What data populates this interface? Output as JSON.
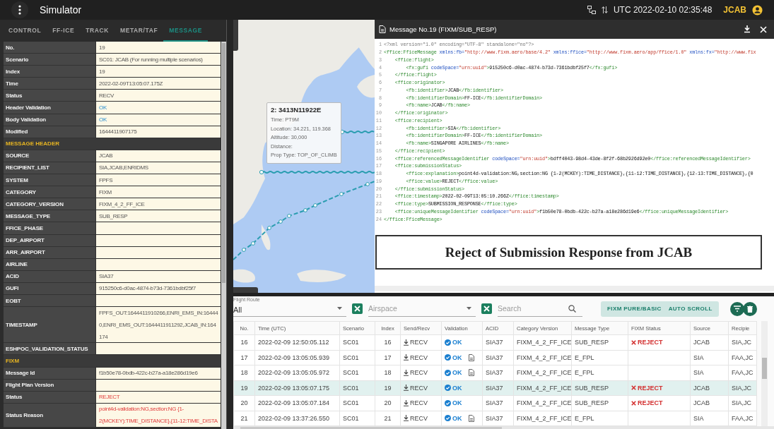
{
  "app_bar": {
    "title": "Simulator",
    "clock": "UTC 2022-02-10 02:35:48",
    "user": "JCAB"
  },
  "tabs": [
    {
      "label": "CONTROL",
      "selected": false
    },
    {
      "label": "FF-ICE",
      "selected": false
    },
    {
      "label": "TRACK",
      "selected": false
    },
    {
      "label": "METAR/TAF",
      "selected": false
    },
    {
      "label": "MESSAGE",
      "selected": true
    }
  ],
  "details": [
    {
      "kind": "field",
      "label": "No.",
      "value": "19"
    },
    {
      "kind": "field",
      "label": "Scenario",
      "value": "SC01: JCAB (For running multiple scenarios)"
    },
    {
      "kind": "field",
      "label": "Index",
      "value": "19"
    },
    {
      "kind": "field",
      "label": "Time",
      "value": "2022-02-09T13:05:07.175Z"
    },
    {
      "kind": "field",
      "label": "Status",
      "value": "RECV"
    },
    {
      "kind": "field",
      "label": "Header Validation",
      "value": "OK",
      "valid": true
    },
    {
      "kind": "field",
      "label": "Body Validation",
      "value": "OK",
      "valid": true
    },
    {
      "kind": "field",
      "label": "Modified",
      "value": "1644411907175"
    },
    {
      "kind": "section",
      "label": "MESSAGE HEADER"
    },
    {
      "kind": "field",
      "label": "SOURCE",
      "value": "JCAB"
    },
    {
      "kind": "field",
      "label": "RECIPIENT_LIST",
      "value": "SIA,JCAB,ENRIDMS"
    },
    {
      "kind": "field",
      "label": "SYSTEM",
      "value": "FPFS"
    },
    {
      "kind": "field",
      "label": "CATEGORY",
      "value": "FIXM"
    },
    {
      "kind": "field",
      "label": "CATEGORY_VERSION",
      "value": "FIXM_4_2_FF_ICE"
    },
    {
      "kind": "field",
      "label": "MESSAGE_TYPE",
      "value": "SUB_RESP"
    },
    {
      "kind": "field",
      "label": "FFICE_PHASE"
    },
    {
      "kind": "field",
      "label": "DEP_AIRPORT"
    },
    {
      "kind": "field",
      "label": "ARR_AIRPORT"
    },
    {
      "kind": "field",
      "label": "AIRLINE"
    },
    {
      "kind": "field",
      "label": "ACID",
      "value": "SIA37"
    },
    {
      "kind": "field",
      "label": "GUFI",
      "value": "915250c6-d0ac-4874-b73d-7361bdbf25f7"
    },
    {
      "kind": "field",
      "label": "EOBT"
    },
    {
      "kind": "field",
      "label": "TIMESTAMP",
      "value_lines": [
        "FPFS_OUT:1644411910266,ENRI_EMS_IN:16444",
        "0,ENRI_EMS_OUT:1644411911292,JCAB_IN:164",
        "174"
      ]
    },
    {
      "kind": "field",
      "label": "ESHPOC_VALIDATION_STATUS"
    },
    {
      "kind": "section",
      "label": "FIXM"
    },
    {
      "kind": "field",
      "label": "Message Id",
      "value": "f1b50e78-0bdb-422c-b27a-a18e286d19e6"
    },
    {
      "kind": "field",
      "label": "Flight Plan Version"
    },
    {
      "kind": "field",
      "label": "Status",
      "value": "REJECT",
      "valid": false
    },
    {
      "kind": "field",
      "label": "Status Reason",
      "valid": false,
      "value_lines": [
        "point4d-validation:NG,section:NG {1-",
        "2(MCKEY):TIME_DISTANCE},{11-12:TIME_DISTA"
      ]
    }
  ],
  "map": {
    "popup": {
      "title": "2: 3413N11922E",
      "lines": [
        "Time: PT9M",
        "Location: 34.221, 119.368",
        "Altitude: 30,000",
        "Distance:",
        "Prop Type: TOP_OF_CLIMB"
      ]
    }
  },
  "message_viewer": {
    "title": "Message No.19 (FIXM/SUB_RESP)",
    "lines": [
      {
        "number": "1",
        "code": "<?xml version=\"1.0\" encoding=\"UTF-8\" standalone=\"no\"?>"
      },
      {
        "number": "2",
        "code": "<ffice:FficeMessage xmlns:fb=\"http://www.fixm.aero/base/4.2\" xmlns:ffice=\"http://www.fixm.aero/app/ffice/1.0\" xmlns:fx=\"http://www.fix"
      },
      {
        "number": "3",
        "code": "    <ffice:flight>"
      },
      {
        "number": "4",
        "code": "        <fx:gufi codeSpace=\"urn:uuid\">915250c6-d0ac-4874-b73d-7361bdbf25f7</fx:gufi>"
      },
      {
        "number": "5",
        "code": "    </ffice:flight>"
      },
      {
        "number": "6",
        "code": "    <ffice:originator>"
      },
      {
        "number": "7",
        "code": "        <fb:identifier>JCAB</fb:identifier>"
      },
      {
        "number": "8",
        "code": "        <fb:identifierDomain>FF-ICE</fb:identifierDomain>"
      },
      {
        "number": "9",
        "code": "        <fb:name>JCAB</fb:name>"
      },
      {
        "number": "10",
        "code": "    </ffice:originator>"
      },
      {
        "number": "11",
        "code": "    <ffice:recipient>"
      },
      {
        "number": "12",
        "code": "        <fb:identifier>SIA</fb:identifier>"
      },
      {
        "number": "13",
        "code": "        <fb:identifierDomain>FF-ICE</fb:identifierDomain>"
      },
      {
        "number": "14",
        "code": "        <fb:name>SINGAPORE AIRLINES</fb:name>"
      },
      {
        "number": "15",
        "code": "    </ffice:recipient>"
      },
      {
        "number": "16",
        "code": "    <ffice:referencedMessageIdentifier codeSpace=\"urn:uuid\">bdff4043-98d4-43de-8f2f-68b2926d92e0</ffice:referencedMessageIdentifier>"
      },
      {
        "number": "17",
        "code": "    <ffice:submissionStatus>"
      },
      {
        "number": "18",
        "code": "        <ffice:explanation>point4d-validation:NG,section:NG {1-2(MCKEY):TIME_DISTANCE},{11-12:TIME_DISTANCE},{12-13:TIME_DISTANCE},{0"
      },
      {
        "number": "19",
        "code": "        <ffice:value>REJECT</ffice:value>"
      },
      {
        "number": "20",
        "code": "    </ffice:submissionStatus>"
      },
      {
        "number": "21",
        "code": "    <ffice:timestamp>2022-02-09T13:05:10.266Z</ffice:timestamp>"
      },
      {
        "number": "22",
        "code": "    <ffice:type>SUBMISSION_RESPONSE</ffice:type>"
      },
      {
        "number": "23",
        "code": "    <ffice:uniqueMessageIdentifier codeSpace=\"urn:uuid\">f1b50e78-0bdb-422c-b27a-a18e286d19e6</ffice:uniqueMessageIdentifier>"
      },
      {
        "number": "24",
        "code": "</ffice:FficeMessage>"
      }
    ]
  },
  "annotation": "Reject of Submission Response from JCAB",
  "filters": {
    "flight_route": {
      "label": "Flight Route",
      "value": "All"
    },
    "airspace": {
      "placeholder": "Airspace"
    },
    "search": {
      "placeholder": "Search"
    },
    "toggles": [
      "FIXM PURE/BASIC",
      "AUTO SCROLL"
    ]
  },
  "table": {
    "columns": [
      "No.",
      "Time (UTC)",
      "Scenario",
      "Index",
      "Send/Recv",
      "Validation",
      "ACID",
      "Category Version",
      "Message Type",
      "FIXM Status",
      "Source",
      "Recipie"
    ],
    "rows": [
      {
        "selected": false,
        "no": "16",
        "time": "2022-02-09 12:50:05.112",
        "scenario": "SC01",
        "index": "16",
        "direction": "RECV",
        "validation": "OK",
        "document": false,
        "acid": "SIA37",
        "category_version": "FIXM_4_2_FF_ICE",
        "message_type": "SUB_RESP",
        "fixm_status": "REJECT",
        "source": "JCAB",
        "recipient": "SIA,JC"
      },
      {
        "selected": false,
        "no": "17",
        "time": "2022-02-09 13:05:05.939",
        "scenario": "SC01",
        "index": "17",
        "direction": "RECV",
        "validation": "OK",
        "document": true,
        "acid": "SIA37",
        "category_version": "FIXM_4_2_FF_ICE",
        "message_type": "E_FPL",
        "source": "SIA",
        "recipient": "FAA,JC"
      },
      {
        "selected": false,
        "no": "18",
        "time": "2022-02-09 13:05:05.972",
        "scenario": "SC01",
        "index": "18",
        "direction": "RECV",
        "validation": "OK",
        "document": true,
        "acid": "SIA37",
        "category_version": "FIXM_4_2_FF_ICE",
        "message_type": "E_FPL",
        "source": "SIA",
        "recipient": "FAA,JC"
      },
      {
        "selected": true,
        "no": "19",
        "time": "2022-02-09 13:05:07.175",
        "scenario": "SC01",
        "index": "19",
        "direction": "RECV",
        "validation": "OK",
        "document": false,
        "acid": "SIA37",
        "category_version": "FIXM_4_2_FF_ICE",
        "message_type": "SUB_RESP",
        "fixm_status": "REJECT",
        "source": "JCAB",
        "recipient": "SIA,JC"
      },
      {
        "selected": false,
        "no": "20",
        "time": "2022-02-09 13:05:07.184",
        "scenario": "SC01",
        "index": "20",
        "direction": "RECV",
        "validation": "OK",
        "document": false,
        "acid": "SIA37",
        "category_version": "FIXM_4_2_FF_ICE",
        "message_type": "SUB_RESP",
        "fixm_status": "REJECT",
        "source": "JCAB",
        "recipient": "SIA,JC"
      },
      {
        "selected": false,
        "no": "21",
        "time": "2022-02-09 13:37:26.550",
        "scenario": "SC01",
        "index": "21",
        "direction": "RECV",
        "validation": "OK",
        "document": true,
        "acid": "SIA37",
        "category_version": "FIXM_4_2_FF_ICE",
        "message_type": "E_FPL",
        "source": "SIA",
        "recipient": "FAA,JC"
      }
    ]
  }
}
